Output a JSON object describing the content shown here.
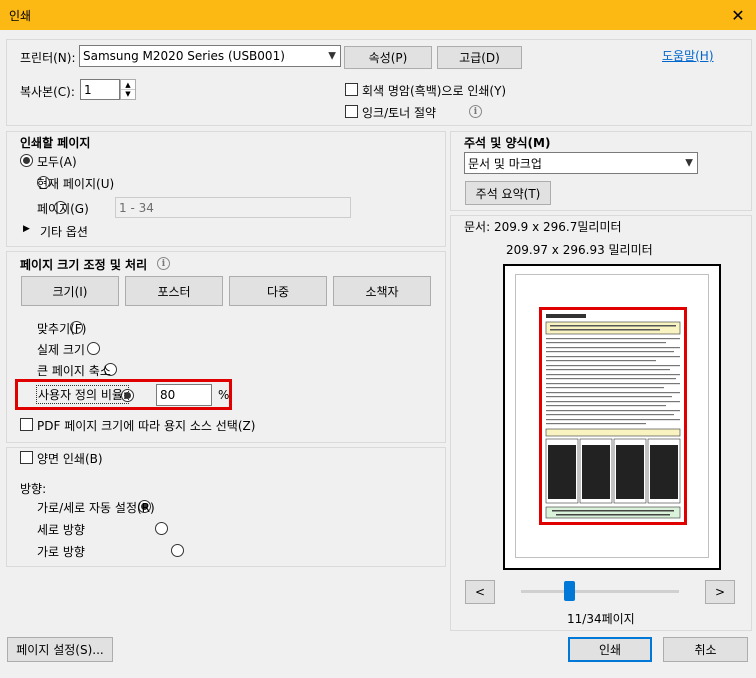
{
  "window": {
    "title": "인쇄",
    "close_glyph": "✕"
  },
  "printer": {
    "label": "프린터(N):",
    "selected": "Samsung M2020 Series (USB001)",
    "properties_button": "속성(P)",
    "advanced_button": "고급(D)",
    "help_link": "도움말(H)",
    "copies_label": "복사본(C):",
    "copies_value": "1",
    "grayscale_label": "회색 명암(흑백)으로 인쇄(Y)",
    "grayscale_checked": false,
    "save_ink_label": "잉크/토너 절약",
    "save_ink_checked": false
  },
  "pages": {
    "heading": "인쇄할 페이지",
    "all_label": "모두(A)",
    "current_label": "현재 페이지(U)",
    "range_label": "페이지(G)",
    "range_value": "1 - 34",
    "more_options": "기타 옵션",
    "selected": "all"
  },
  "sizing": {
    "heading": "페이지 크기 조정 및 처리",
    "tabs": [
      "크기(I)",
      "포스터",
      "다중",
      "소책자"
    ],
    "fit_label": "맞추기(F)",
    "actual_label": "실제 크기",
    "shrink_label": "큰 페이지 축소",
    "custom_label": "사용자 정의 비율:",
    "custom_value": "80",
    "percent_sign": "%",
    "pdf_paper_label": "PDF 페이지 크기에 따라 용지 소스 선택(Z)",
    "selected": "custom"
  },
  "duplex": {
    "label": "양면 인쇄(B)",
    "checked": false
  },
  "orientation": {
    "heading": "방향:",
    "auto_label": "가로/세로 자동 설정(R)",
    "portrait_label": "세로 방향",
    "landscape_label": "가로 방향",
    "selected": "auto"
  },
  "comments": {
    "heading": "주석 및 양식(M)",
    "selected": "문서 및 마크업",
    "summarize_button": "주석 요약(T)"
  },
  "preview": {
    "doc_size": "문서: 209.9 x 296.7밀리미터",
    "paper_size": "209.97 x 296.93 밀리미터",
    "prev_glyph": "<",
    "next_glyph": ">",
    "page_indicator": "11/34페이지",
    "page_current": 11,
    "page_total": 34
  },
  "footer": {
    "page_setup_button": "페이지 설정(S)...",
    "print_button": "인쇄",
    "cancel_button": "취소"
  },
  "colors": {
    "title_bar": "#fcb813",
    "highlight_red": "#e00000",
    "link_blue": "#0066cc",
    "accent_blue": "#0078d7"
  }
}
